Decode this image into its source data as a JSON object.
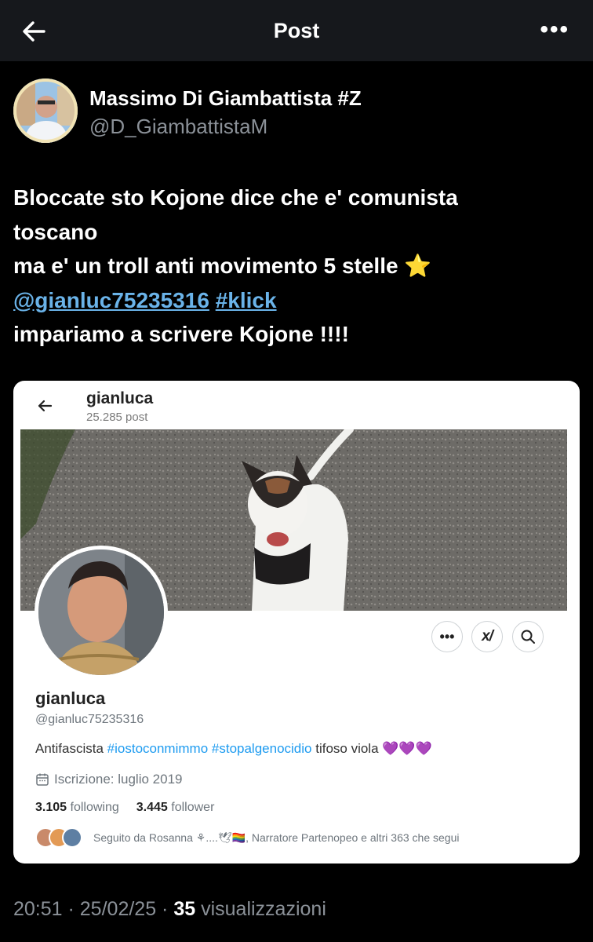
{
  "header": {
    "title": "Post",
    "more": "•••"
  },
  "author": {
    "name": "Massimo Di Giambattista #Z",
    "handle": "@D_GiambattistaM"
  },
  "post": {
    "line1": "Bloccate sto Kojone dice che e' comunista",
    "line2": "toscano",
    "line3": "ma e' un troll anti movimento 5 stelle ⭐",
    "mention": "@gianluc75235316",
    "hashtag": "#klick",
    "line5": "impariamo a scrivere Kojone !!!!"
  },
  "screenshot_card": {
    "top_name": "gianluca",
    "post_count": "25.285 post",
    "profile": {
      "name": "gianluca",
      "handle": "@gianluc75235316",
      "bio_prefix": "Antifascista ",
      "bio_tag1": "#iostoconmimmo",
      "bio_tag2": "#stopalgenocidio",
      "bio_suffix": " tifoso viola 💜💜💜",
      "joined": "Iscrizione: luglio 2019",
      "following_count": "3.105",
      "following_label": "following",
      "followers_count": "3.445",
      "followers_label": "follower",
      "followed_by": "Seguito da Rosanna ⚘....🕊🏳️‍🌈, Narratore Partenopeo e altri 363 che segui"
    },
    "action_buttons": {
      "more": "•••",
      "xai": "x/",
      "search": "search"
    }
  },
  "footer": {
    "time": "20:51",
    "sep1": " · ",
    "date": "25/02/25",
    "sep2": " · ",
    "views_count": "35",
    "views_label": " visualizzazioni"
  }
}
